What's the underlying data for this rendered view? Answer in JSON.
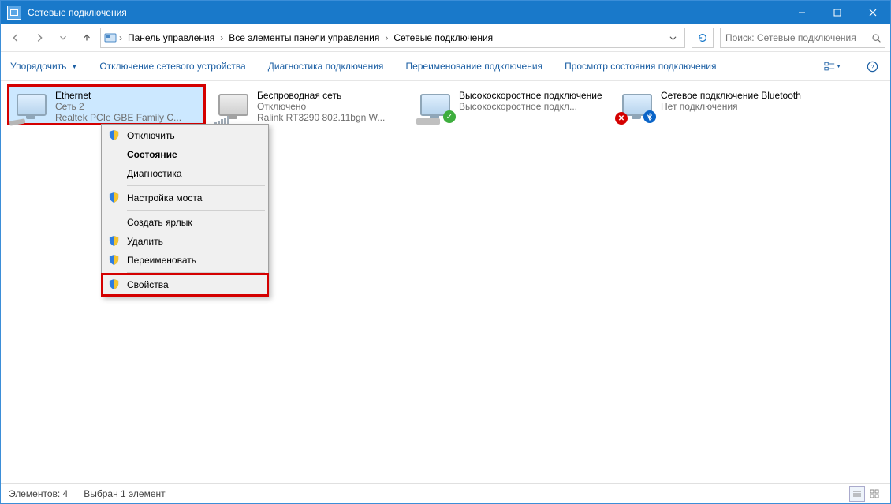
{
  "title": "Сетевые подключения",
  "breadcrumbs": [
    "Панель управления",
    "Все элементы панели управления",
    "Сетевые подключения"
  ],
  "search_placeholder": "Поиск: Сетевые подключения",
  "commands": {
    "organize": "Упорядочить",
    "disable": "Отключение сетевого устройства",
    "diagnose": "Диагностика подключения",
    "rename": "Переименование подключения",
    "status": "Просмотр состояния подключения"
  },
  "items": [
    {
      "name": "Ethernet",
      "line2": "Сеть  2",
      "line3": "Realtek PCIe GBE Family C..."
    },
    {
      "name": "Беспроводная сеть",
      "line2": "Отключено",
      "line3": "Ralink RT3290 802.11bgn W..."
    },
    {
      "name": "Высокоскоростное подключение",
      "line2": "",
      "line3": "Высокоскоростное подкл..."
    },
    {
      "name": "Сетевое подключение Bluetooth",
      "line2": "",
      "line3": "Нет подключения"
    }
  ],
  "context_menu": {
    "items": [
      {
        "label": "Отключить",
        "shield": true
      },
      {
        "label": "Состояние",
        "bold": true
      },
      {
        "label": "Диагностика"
      },
      {
        "sep": true
      },
      {
        "label": "Настройка моста",
        "shield": true
      },
      {
        "sep": true
      },
      {
        "label": "Создать ярлык"
      },
      {
        "label": "Удалить",
        "shield": true
      },
      {
        "label": "Переименовать",
        "shield": true
      },
      {
        "sep": true
      },
      {
        "label": "Свойства",
        "shield": true,
        "highlight": true
      }
    ]
  },
  "status_bar": {
    "count": "Элементов: 4",
    "selected": "Выбран 1 элемент"
  }
}
